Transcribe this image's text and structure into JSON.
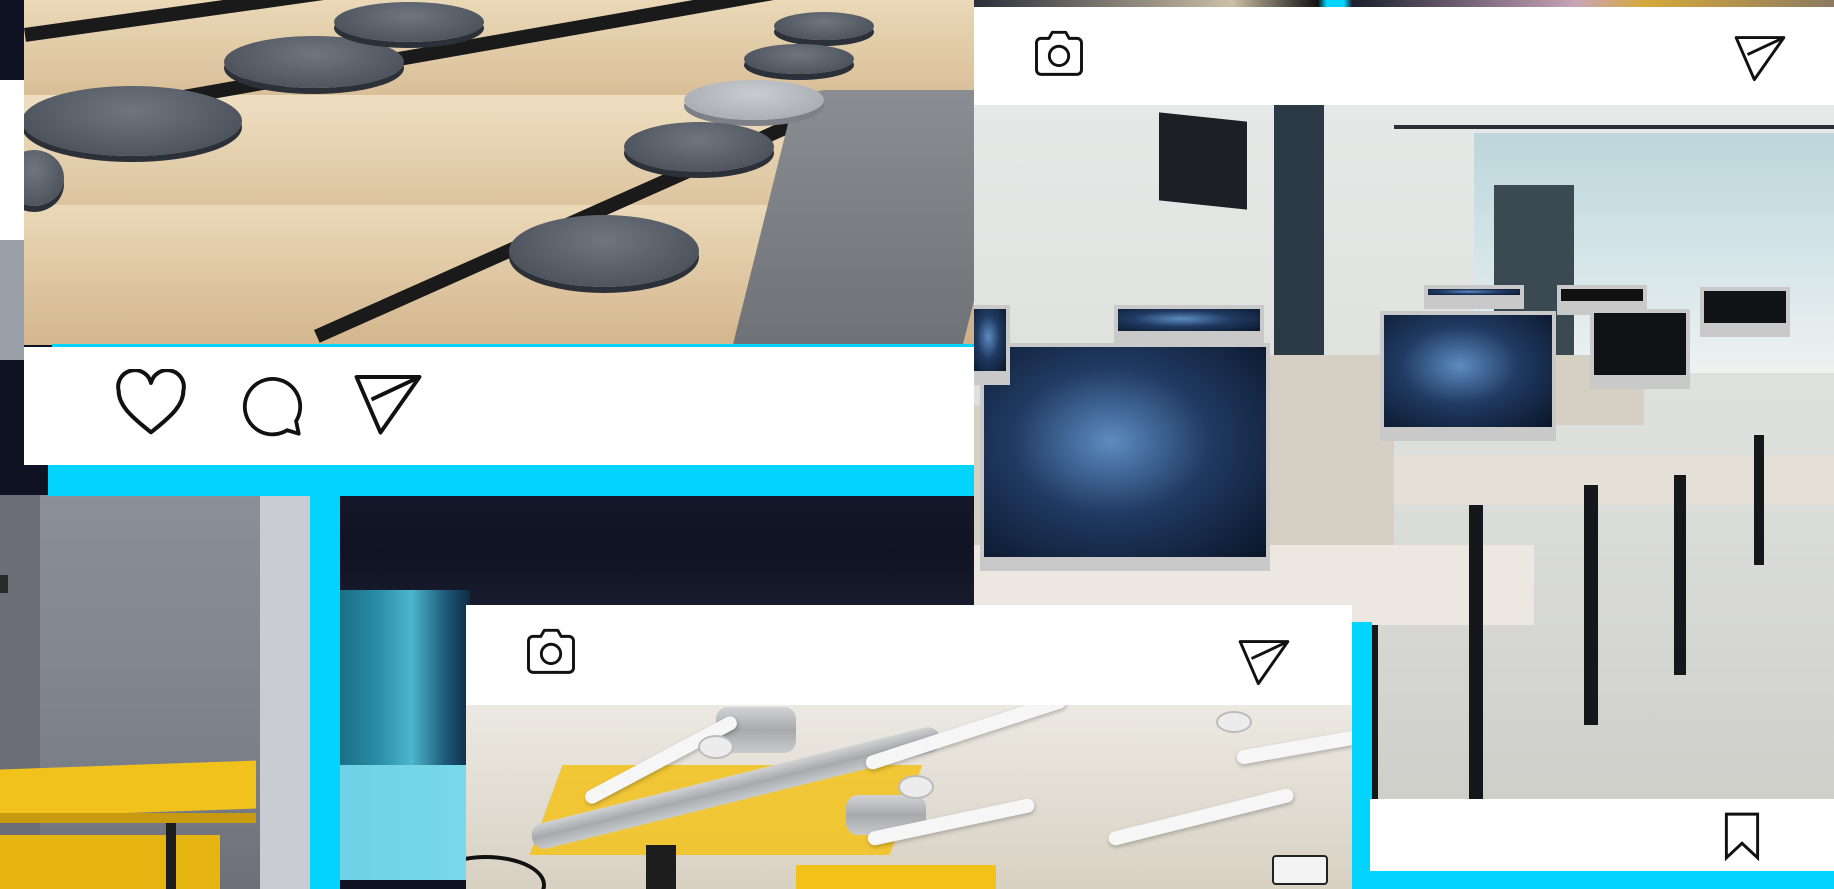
{
  "colors": {
    "accent": "#00d4ff",
    "navy": "#0e1222",
    "card": "#ffffff",
    "icon_stroke": "#111111"
  },
  "cards": {
    "post_top_left": {
      "photo": "auditorium-steps-photo",
      "actions": [
        "heart-icon",
        "comment-icon",
        "send-icon"
      ]
    },
    "post_right": {
      "header_icons": [
        "camera-icon",
        "send-icon"
      ],
      "photo": "office-computers-photo",
      "footer_icons": [
        "bookmark-icon"
      ]
    },
    "post_bottom_center": {
      "header_icons": [
        "camera-icon",
        "send-icon"
      ],
      "photo": "ceiling-lights-photo"
    }
  }
}
